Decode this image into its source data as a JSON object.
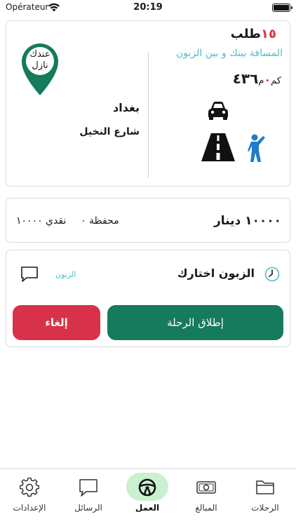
{
  "status_bar": {
    "carrier": "Opérateur",
    "time": "20:19"
  },
  "order": {
    "title": "طلب",
    "number": "١٥",
    "distance_text": "المسافة بينك و بين الزبون",
    "distance_km": "٤٣٦",
    "distance_km_unit": "كم",
    "distance_m": "٠",
    "distance_m_unit": "م",
    "city": "بغداد",
    "street": "شارع النخيل",
    "pin_text_line1": "عندك",
    "pin_text_line2": "نازل"
  },
  "payment": {
    "price": "١٠٠٠٠ دينار",
    "wallet": "محفظة ٠",
    "cash": "نقدي ١٠٠٠٠"
  },
  "trip_status": {
    "message": "الزبون اختارك",
    "customer_label": "الزبون",
    "start_button": "إطلاق الرحلة",
    "cancel_button": "إلغاء"
  },
  "tabs": [
    {
      "label": "الإعدادات",
      "icon": "gear-icon"
    },
    {
      "label": "الرسائل",
      "icon": "chat-bubble-icon"
    },
    {
      "label": "العمل",
      "icon": "steering-wheel-icon",
      "active": true
    },
    {
      "label": "المبالغ",
      "icon": "banknote-icon"
    },
    {
      "label": "الرحلات",
      "icon": "folder-icon"
    }
  ],
  "colors": {
    "primary_green": "#167a5c",
    "cancel_red": "#d8324a",
    "accent_cyan": "#4dbfc8",
    "active_tab_bg": "#c9f0cf"
  }
}
